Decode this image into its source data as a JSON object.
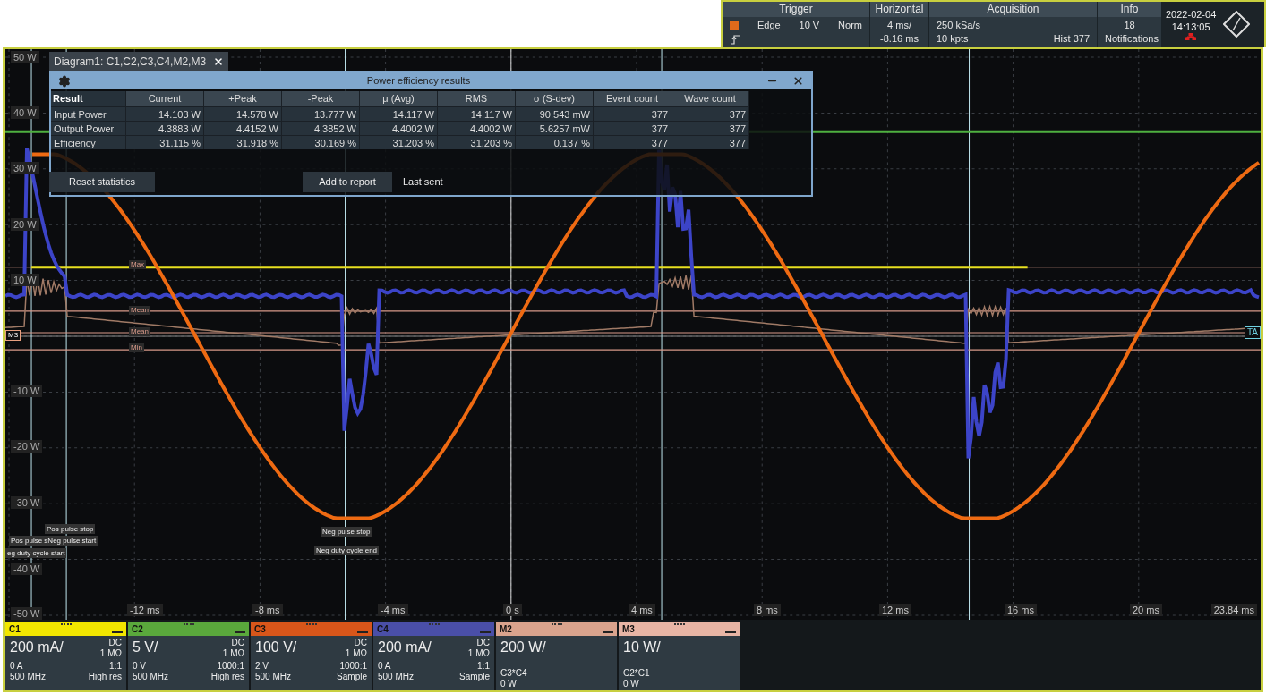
{
  "top_bar": {
    "trigger": {
      "title": "Trigger",
      "type": "Edge",
      "threshold": "10 V",
      "mode": "Norm"
    },
    "horizontal": {
      "title": "Horizontal",
      "scale": "4 ms/",
      "position": "-8.16 ms"
    },
    "acquisition": {
      "title": "Acquisition",
      "rate": "250 kSa/s",
      "length": "10 kpts",
      "history": "Hist 377"
    },
    "info": {
      "title": "Info",
      "count": "18",
      "label": "Notifications"
    },
    "date": "2022-02-04",
    "time": "14:13:05"
  },
  "diagram_tab": {
    "label": "Diagram1: C1,C2,C3,C4,M2,M3"
  },
  "results_dialog": {
    "title": "Power efficiency results",
    "columns": [
      "Result",
      "Current",
      "+Peak",
      "-Peak",
      "μ (Avg)",
      "RMS",
      "σ (S-dev)",
      "Event count",
      "Wave count"
    ],
    "rows": [
      [
        "Input Power",
        "14.103 W",
        "14.578 W",
        "13.777 W",
        "14.117 W",
        "14.117 W",
        "90.543 mW",
        "377",
        "377"
      ],
      [
        "Output Power",
        "4.3883 W",
        "4.4152 W",
        "4.3852 W",
        "4.4002 W",
        "4.4002 W",
        "5.6257 mW",
        "377",
        "377"
      ],
      [
        "Efficiency",
        "31.115 %",
        "31.918 %",
        "30.169 %",
        "31.203 %",
        "31.203 %",
        "0.137 %",
        "377",
        "377"
      ]
    ],
    "buttons": [
      "Reset statistics",
      "Add to report"
    ],
    "status": "Last sent"
  },
  "plot": {
    "y_labels": [
      "50 W",
      "40 W",
      "30 W",
      "20 W",
      "10 W",
      "-10 W",
      "-20 W",
      "-30 W",
      "-40 W",
      "-50 W"
    ],
    "x_labels": [
      "-12 ms",
      "-8 ms",
      "-4 ms",
      "0 s",
      "4 ms",
      "8 ms",
      "12 ms",
      "16 ms",
      "20 ms",
      "23.84 ms"
    ],
    "stat_labels": [
      "Max",
      "Mean",
      "Mean",
      "Min"
    ],
    "annotations": [
      "Pos pulse stop",
      "Pos pulse sNeg pulse start",
      "eg duty cycle start",
      "Neg pulse stop",
      "Neg duty cycle end"
    ],
    "left_marker": "M3",
    "right_marker": "TA"
  },
  "channels": [
    {
      "kind": "input",
      "name": "C1",
      "color": "#f2e600",
      "scale": "200 mA/",
      "coupling": "DC",
      "impedance": "1 MΩ",
      "offset": "0 A",
      "ratio": "1:1",
      "bandwidth": "500 MHz",
      "mode": "High res"
    },
    {
      "kind": "input",
      "name": "C2",
      "color": "#5aa83c",
      "scale": "5 V/",
      "coupling": "DC",
      "impedance": "1 MΩ",
      "offset": "0 V",
      "ratio": "1000:1",
      "bandwidth": "500 MHz",
      "mode": "High res"
    },
    {
      "kind": "input",
      "name": "C3",
      "color": "#d8561a",
      "scale": "100 V/",
      "coupling": "DC",
      "impedance": "1 MΩ",
      "offset": "2 V",
      "ratio": "1000:1",
      "bandwidth": "500 MHz",
      "mode": "Sample"
    },
    {
      "kind": "input",
      "name": "C4",
      "color": "#4a4fa8",
      "scale": "200 mA/",
      "coupling": "DC",
      "impedance": "1 MΩ",
      "offset": "0 A",
      "ratio": "1:1",
      "bandwidth": "500 MHz",
      "mode": "Sample"
    },
    {
      "kind": "math",
      "name": "M2",
      "color": "#d9a38d",
      "scale": "200 W/",
      "formula": "C3*C4",
      "value": "0 W"
    },
    {
      "kind": "math",
      "name": "M3",
      "color": "#e8b5a5",
      "scale": "10 W/",
      "formula": "C2*C1",
      "value": "0 W"
    }
  ]
}
